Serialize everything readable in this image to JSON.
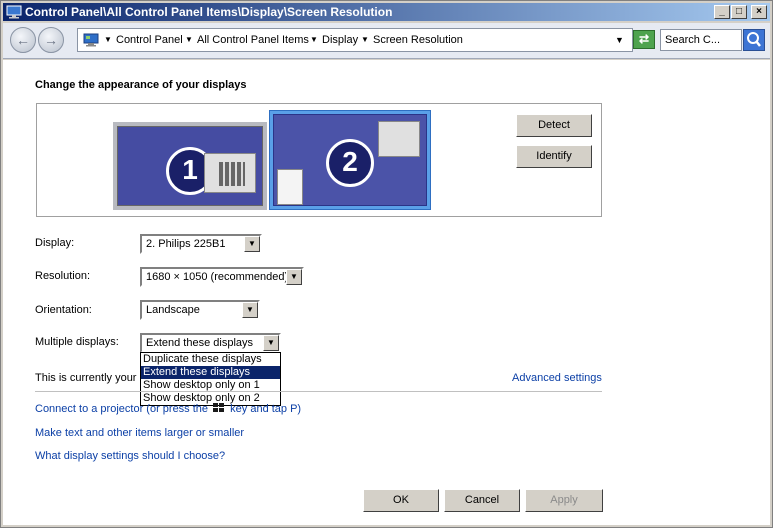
{
  "window": {
    "title": "Control Panel\\All Control Panel Items\\Display\\Screen Resolution",
    "minimize": "_",
    "maximize": "□",
    "close": "×"
  },
  "addressbar": {
    "back_icon": "back-arrow-icon",
    "forward_icon": "forward-arrow-icon",
    "crumbs": [
      "Control Panel",
      "All Control Panel Items",
      "Display",
      "Screen Resolution"
    ],
    "refresh_icon": "refresh-icon",
    "search_placeholder": "Search C..."
  },
  "main": {
    "heading": "Change the appearance of your displays",
    "monitors": [
      {
        "number": "1",
        "selected": false
      },
      {
        "number": "2",
        "selected": true
      }
    ],
    "detect_label": "Detect",
    "identify_label": "Identify",
    "display_label": "Display:",
    "display_value": "2. Philips 225B1",
    "resolution_label": "Resolution:",
    "resolution_value": "1680 × 1050 (recommended)",
    "orientation_label": "Orientation:",
    "orientation_value": "Landscape",
    "multiple_label": "Multiple displays:",
    "multiple_value": "Extend these displays",
    "multiple_options": [
      "Duplicate these displays",
      "Extend these displays",
      "Show desktop only on 1",
      "Show desktop only on 2"
    ],
    "multiple_selected_index": 1,
    "currently_text": "This is currently your",
    "advanced_link": "Advanced settings",
    "projector_link_before": "Connect to a projector (or press the",
    "projector_link_after": "key and tap P)",
    "text_size_link": "Make text and other items larger or smaller",
    "settings_link": "What display settings should I choose?"
  },
  "footer": {
    "ok_label": "OK",
    "cancel_label": "Cancel",
    "apply_label": "Apply"
  },
  "colors": {
    "accent": "#0a246a",
    "link": "#0b3fa6",
    "monitor_blue": "#454ca2",
    "selected_border": "#5aa0e8"
  }
}
